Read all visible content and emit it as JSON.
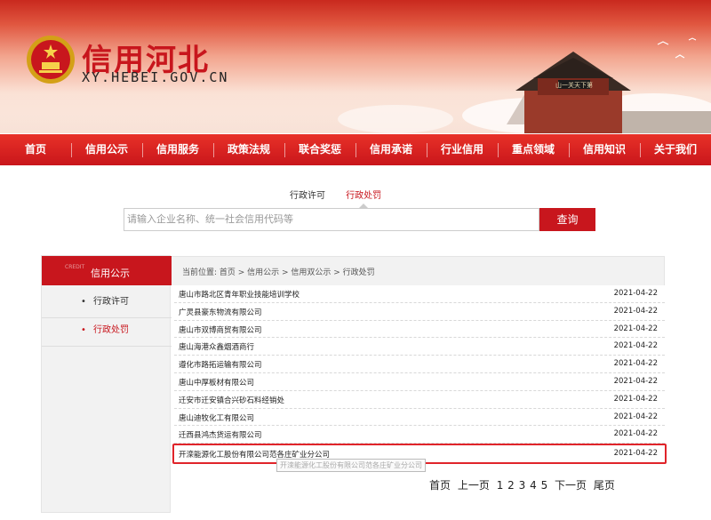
{
  "header": {
    "title": "信用河北",
    "domain": "XY.HEBEI.GOV.CN",
    "gate_sign": "山一关天下第"
  },
  "nav": [
    "首页",
    "信用公示",
    "信用服务",
    "政策法规",
    "联合奖惩",
    "信用承诺",
    "行业信用",
    "重点领域",
    "信用知识",
    "关于我们"
  ],
  "search": {
    "tabs": [
      "行政许可",
      "行政处罚"
    ],
    "active_tab": "行政处罚",
    "placeholder": "请输入企业名称、统一社会信用代码等",
    "button": "查询"
  },
  "sidebar": {
    "watermark": "CREDIT",
    "title": "信用公示",
    "items": [
      {
        "label": "行政许可",
        "dot": "•"
      },
      {
        "label": "行政处罚",
        "dot": "•"
      }
    ]
  },
  "breadcrumb": "当前位置: 首页 > 信用公示 > 信用双公示 > 行政处罚",
  "records": [
    {
      "name": "唐山市路北区青年职业技能培训学校",
      "date": "2021-04-22"
    },
    {
      "name": "广灵县豪东物流有限公司",
      "date": "2021-04-22"
    },
    {
      "name": "唐山市双博商贸有限公司",
      "date": "2021-04-22"
    },
    {
      "name": "唐山海港众鑫烟酒商行",
      "date": "2021-04-22"
    },
    {
      "name": "遵化市路拓运输有限公司",
      "date": "2021-04-22"
    },
    {
      "name": "唐山中厚板材有限公司",
      "date": "2021-04-22"
    },
    {
      "name": "迁安市迁安镇合兴砂石料经销处",
      "date": "2021-04-22"
    },
    {
      "name": "唐山迪牧化工有限公司",
      "date": "2021-04-22"
    },
    {
      "name": "迁西县鸿杰货运有限公司",
      "date": "2021-04-22"
    },
    {
      "name": "开滦能源化工股份有限公司范各庄矿业分公司",
      "date": "2021-04-22"
    }
  ],
  "tooltip": "开滦能源化工股份有限公司范各庄矿业分公司",
  "pager": {
    "first": "首页",
    "prev": "上一页",
    "pages": [
      "1",
      "2",
      "3",
      "4",
      "5"
    ],
    "next": "下一页",
    "last": "尾页"
  },
  "colors": {
    "brand": "#c8161d"
  }
}
